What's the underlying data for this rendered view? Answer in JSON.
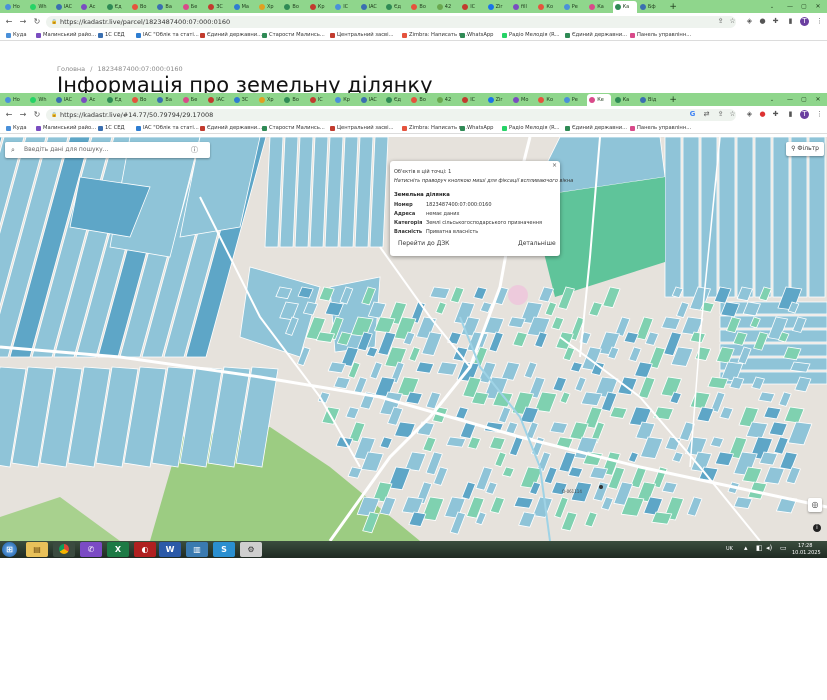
{
  "background_window": {
    "tabs": [
      "Но",
      "Wh",
      "IAC",
      "Ас",
      "Єд",
      "Во",
      "Ва",
      "Бе",
      "ЗС",
      "Ма",
      "Хр",
      "Во",
      "Кр",
      "ІС",
      "IAC",
      "Єд",
      "Во",
      "42",
      "ІС",
      "Zir",
      "fill",
      "Ко",
      "Ре",
      "Ка",
      "Ка",
      "Бф"
    ],
    "url": "https://kadastr.live/parcel/1823487400:07:000:0160",
    "bookmarks": [
      "Куда",
      "Малинський райо...",
      "1С СЕД",
      "IAC \"Облік та статі...",
      "Єдиний державни...",
      "Старости Малинсь...",
      "Центральний засві...",
      "Zimbra: Написать п...",
      "WhatsApp",
      "Радіо Мелодія (R...",
      "Єдиний державни...",
      "Панель управлінн..."
    ],
    "breadcrumb_home": "Головна",
    "breadcrumb_sep": "/",
    "breadcrumb_current": "1823487400:07:000:0160",
    "page_title": "Інформація про земельну ділянку"
  },
  "foreground_window": {
    "tabs": [
      "Но",
      "Wh",
      "IAC",
      "Ас",
      "Єд",
      "Во",
      "Ва",
      "Бе",
      "IAC",
      "ЗС",
      "Хр",
      "Во",
      "ІС",
      "Кр",
      "IAC",
      "Єд",
      "Во",
      "42",
      "ІС",
      "Zir",
      "Мо",
      "Ко",
      "Ре",
      "Ке",
      "Ка",
      "Від"
    ],
    "url": "https://kadastr.live/#14.77/50.79794/29.17008",
    "bookmarks": [
      "Куда",
      "Малинський райо...",
      "1С СЕД",
      "IAC \"Облік та статі...",
      "Єдиний державни...",
      "Старости Малинсь...",
      "Центральний засві...",
      "Zimbra: Написать п...",
      "WhatsApp",
      "Радіо Мелодія (R...",
      "Єдиний державни...",
      "Панель управлінн..."
    ]
  },
  "map": {
    "search_placeholder": "Введіть дані для пошуку...",
    "filter_label": "Фільтр",
    "road_label": "О-061114",
    "popup": {
      "objects_line": "Об'єктів в цій точці: 1",
      "hint_line": "Натисніть праворуч кнопкою миші для фіксації вспливаючого вікна",
      "section_title": "Земельна ділянка",
      "rows": [
        {
          "key": "Номер",
          "value": "1823487400:07:000:0160"
        },
        {
          "key": "Адреса",
          "value": "немає даних"
        },
        {
          "key": "Категорія",
          "value": "Землі сільськогосподарського призначення"
        },
        {
          "key": "Власність",
          "value": "Приватна власність"
        }
      ],
      "link_dzk": "Перейти до ДЗК",
      "link_details": "Детальніше",
      "close": "×"
    },
    "colors": {
      "parcel": "#8fc4d8",
      "parcel_dark": "#5ea6c7",
      "parcel_green": "#7fd1b0",
      "field_green": "#5fc49a",
      "forest": "#9ccc82",
      "water": "#9fd3e6"
    }
  },
  "taskbar": {
    "lang": "UK",
    "time": "17:28",
    "date": "10.01.2025"
  }
}
